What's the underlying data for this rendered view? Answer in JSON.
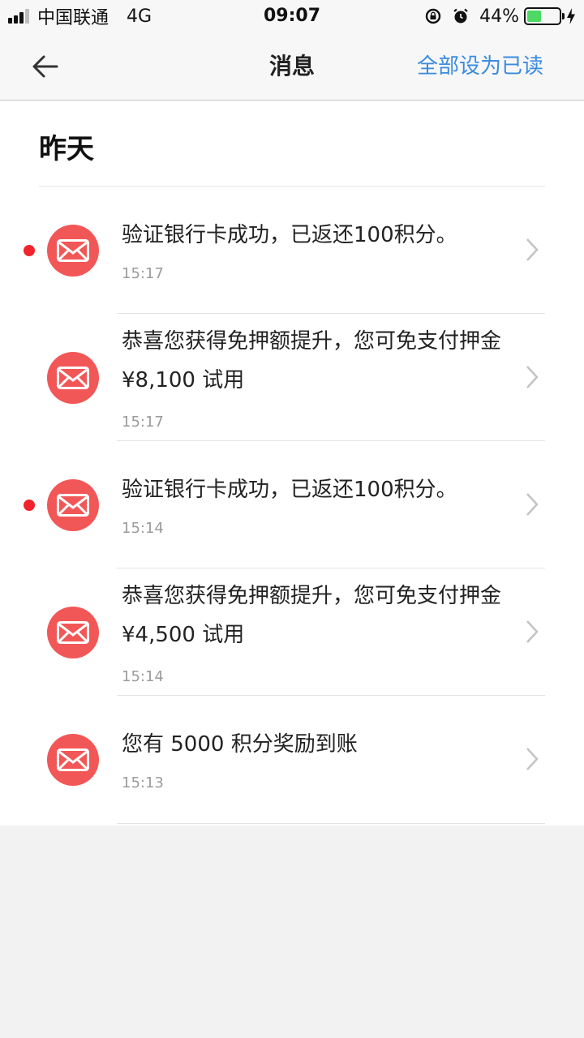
{
  "status_bar": {
    "carrier": "中国联通",
    "network": "4G",
    "time": "09:07",
    "battery": "44%",
    "battery_level": 0.44
  },
  "nav": {
    "title": "消息",
    "action": "全部设为已读"
  },
  "section": {
    "title": "昨天"
  },
  "messages": [
    {
      "text": "验证银行卡成功，已返还100积分。",
      "time": "15:17",
      "unread": true
    },
    {
      "text": "恭喜您获得免押额提升，您可免支付押金¥8,100 试用",
      "time": "15:17",
      "unread": false
    },
    {
      "text": "验证银行卡成功，已返还100积分。",
      "time": "15:14",
      "unread": true
    },
    {
      "text": "恭喜您获得免押额提升，您可免支付押金¥4,500 试用",
      "time": "15:14",
      "unread": false
    },
    {
      "text": "您有 5000 积分奖励到账",
      "time": "15:13",
      "unread": false
    }
  ],
  "colors": {
    "accent": "#3a8be0",
    "icon_bg": "#f25757",
    "unread_dot": "#f0242c"
  }
}
